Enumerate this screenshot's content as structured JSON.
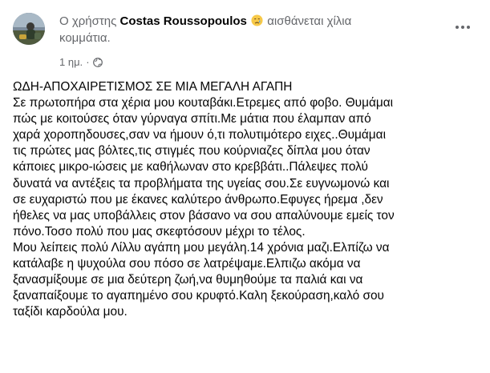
{
  "post": {
    "author_prefix": "Ο χρήστης",
    "author_name": "Costas Roussopoulos",
    "feeling_icon": "crying-face-icon",
    "feeling_text_line1": "αισθάνεται χίλια",
    "feeling_text_line2": "κομμάτια.",
    "timestamp": "1 ημ.",
    "separator": "·",
    "audience_icon": "globe-icon",
    "more_icon": "more-options-icon",
    "body_lines": [
      "ΩΔΗ-ΑΠΟΧΑΙΡΕΤΙΣΜΟΣ ΣΕ ΜΙΑ ΜΕΓΑΛΗ ΑΓΑΠΗ",
      "Σε πρωτοπήρα στα χέρια μου κουταβάκι.Ετρεμες από φοβο. Θυμάμαι",
      "πώς με κοιτούσες όταν γύρναγα σπίτι.Με μάτια που έλαμπαν από",
      "χαρά χοροπηδουσες,σαν να ήμουν ό,τι πολυτιμότερο ειχες..Θυμάμαι",
      "τις πρώτες μας βόλτες,τις στιγμές που κούρνιαζες  δίπλα μου όταν",
      "κάποιες μικρο-ιώσεις με καθήλωναν στο κρεββάτι..Πάλεψες πολύ",
      "δυνατά να αντέξεις τα προβλήματα της υγείας σου.Σε ευγνωμονώ και",
      "σε ευχαριστώ που με έκανες καλύτερο άνθρωπο.Εφυγες ήρεμα ,δεν",
      "ήθελες να μας υποβάλλεις στον βάσανο να σου απαλύνουμε εμείς τον",
      "πόνο.Τοσο πολύ που μας σκεφτόσουν μέχρι το τέλος.",
      "Μου λείπεις πολύ Λίλλυ αγάπη μου μεγάλη.14 χρόνια μαζι.Ελπίζω να",
      "κατάλαβε  η ψυχούλα σου πόσο σε λατρέψαμε.Ελπιζω ακόμα να",
      "ξανασμίξουμε σε μια δεύτερη ζωή,να θυμηθούμε τα παλιά και να",
      "ξαναπαίξουμε το αγαπημένο σου κρυφτό.Καλη ξεκούραση,καλό σου",
      "ταξίδι καρδούλα μου."
    ]
  },
  "colors": {
    "text_primary": "#050505",
    "text_secondary": "#65676b",
    "emoji_face": "#f7c948",
    "emoji_tear": "#5aa9e6"
  }
}
